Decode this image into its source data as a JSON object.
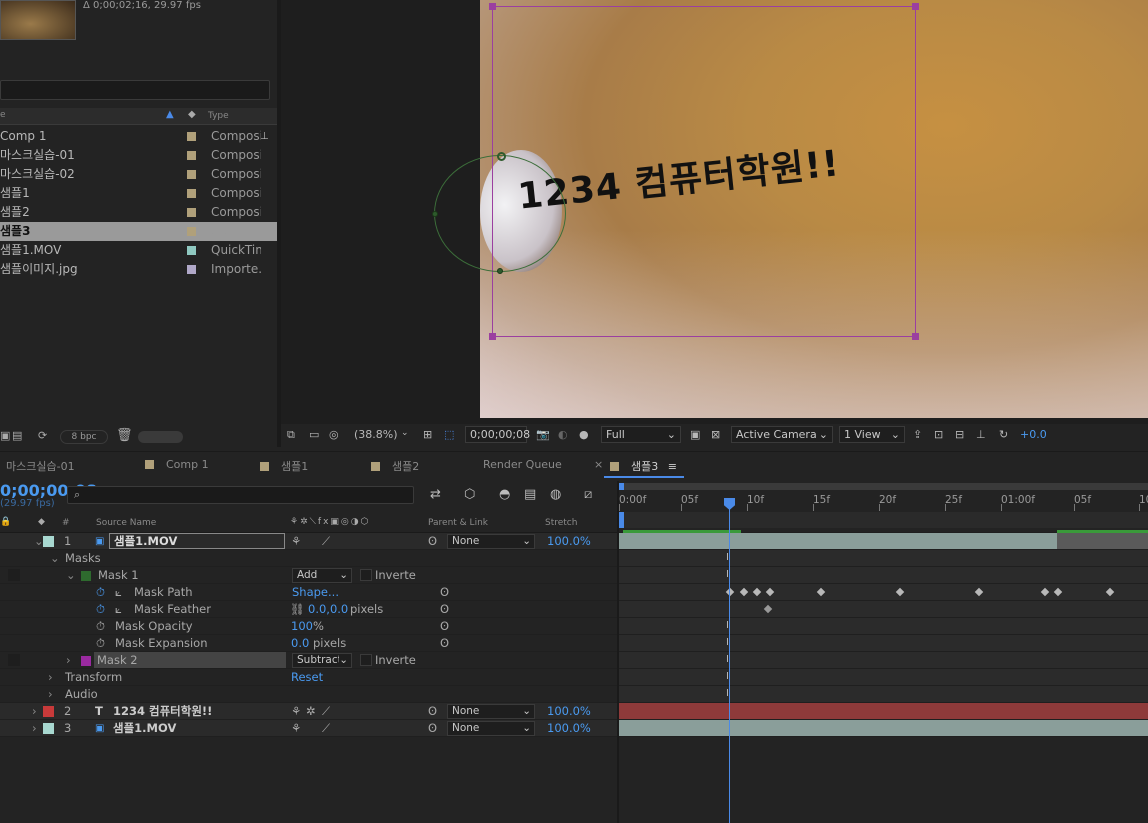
{
  "project": {
    "thumb_info": "Δ 0;00;02;16, 29.97 fps",
    "type_header": "Type",
    "items": [
      {
        "name": "Comp 1",
        "type": "Composi",
        "color": "#b0a07a"
      },
      {
        "name": "마스크실습-01",
        "type": "Composi",
        "color": "#b0a07a"
      },
      {
        "name": "마스크실습-02",
        "type": "Composi",
        "color": "#b0a07a"
      },
      {
        "name": "샘플1",
        "type": "Composi",
        "color": "#b0a07a"
      },
      {
        "name": "샘플2",
        "type": "Composi",
        "color": "#b0a07a"
      },
      {
        "name": "샘플3",
        "type": "Composi",
        "color": "#b0a07a",
        "selected": true
      },
      {
        "name": "샘플1.MOV",
        "type": "QuickTim",
        "color": "#8fc8c0"
      },
      {
        "name": "샘플이미지.jpg",
        "type": "Importe..",
        "color": "#b0a8c8"
      }
    ],
    "bpc": "8 bpc"
  },
  "viewer": {
    "overlay_text": "1234 컴퓨터학원!!",
    "zoom": "(38.8%)",
    "timecode": "0;00;00;08",
    "resolution": "Full",
    "camera": "Active Camera",
    "view": "1 View",
    "exposure": "+0.0"
  },
  "tabs": [
    {
      "label": "마스크실습-01"
    },
    {
      "label": "Comp 1"
    },
    {
      "label": "샘플1"
    },
    {
      "label": "샘플2"
    },
    {
      "label": "Render Queue"
    },
    {
      "label": "샘플3",
      "active": true
    }
  ],
  "timeline": {
    "timecode": "0;00;00;08",
    "fps": "(29.97 fps)",
    "cols": {
      "num": "#",
      "source": "Source Name",
      "parent": "Parent & Link",
      "stretch": "Stretch"
    },
    "layer1": {
      "num": "1",
      "name": "샘플1.MOV",
      "parent": "None",
      "stretch": "100.0%"
    },
    "masks_label": "Masks",
    "mask1": {
      "name": "Mask 1",
      "mode": "Add",
      "inverted": "Inverte"
    },
    "mask_path": {
      "label": "Mask Path",
      "value": "Shape..."
    },
    "mask_feather": {
      "label": "Mask Feather",
      "value": "0.0,0.0",
      "unit": "pixels"
    },
    "mask_opacity": {
      "label": "Mask Opacity",
      "value": "100",
      "unit": "%"
    },
    "mask_expansion": {
      "label": "Mask Expansion",
      "value": "0.0",
      "unit": "pixels"
    },
    "mask2": {
      "name": "Mask 2",
      "mode": "Subtract",
      "inverted": "Inverte"
    },
    "transform": {
      "label": "Transform",
      "value": "Reset"
    },
    "audio": {
      "label": "Audio"
    },
    "layer2": {
      "num": "2",
      "name": "1234 컴퓨터학원!!",
      "parent": "None",
      "stretch": "100.0%"
    },
    "layer3": {
      "num": "3",
      "name": "샘플1.MOV",
      "parent": "None",
      "stretch": "100.0%"
    },
    "ruler": [
      "0:00f",
      "05f",
      "10f",
      "15f",
      "20f",
      "25f",
      "01:00f",
      "05f",
      "10"
    ],
    "colors": {
      "layer1_label": "#a8d8d0",
      "layer2_label": "#c83a3a",
      "layer3_label": "#a8d8d0",
      "mask1": "#2e6a2e",
      "mask2": "#9a2aa0"
    }
  }
}
